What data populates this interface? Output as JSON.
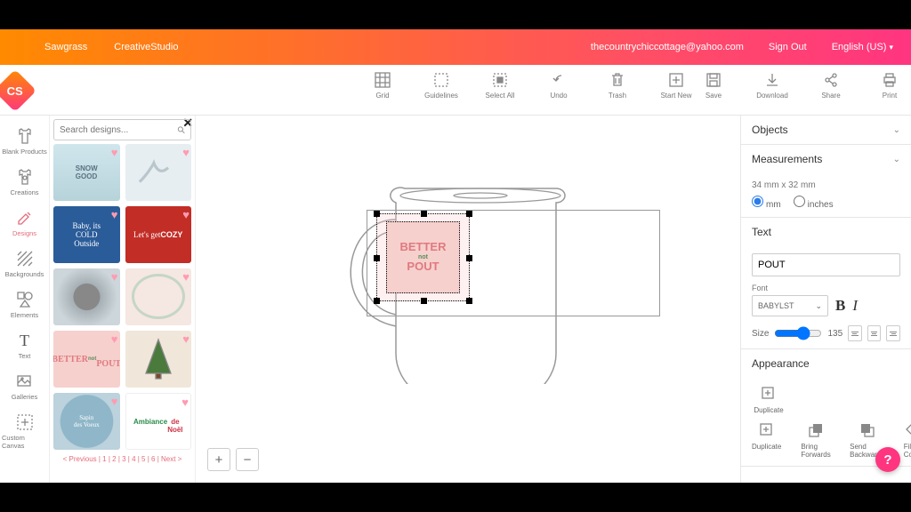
{
  "topbar": {
    "brand1": "Sawgrass",
    "brand2": "CreativeStudio",
    "email": "thecountrychiccottage@yahoo.com",
    "signout": "Sign Out",
    "language": "English (US)"
  },
  "toolbar": {
    "grid": "Grid",
    "guidelines": "Guidelines",
    "select_all": "Select All",
    "undo": "Undo",
    "trash": "Trash",
    "start_new": "Start New",
    "save": "Save",
    "download": "Download",
    "share": "Share",
    "print": "Print"
  },
  "sidebar": {
    "blank_products": "Blank Products",
    "creations": "Creations",
    "designs": "Designs",
    "backgrounds": "Backgrounds",
    "elements": "Elements",
    "text": "Text",
    "galleries": "Galleries",
    "custom_canvas": "Custom Canvas"
  },
  "browser": {
    "search_placeholder": "Search designs...",
    "pager": "< Previous | 1 | 2 | 3 | 4 | 5 | 6 | Next >"
  },
  "canvas": {
    "design_line1": "BETTER",
    "design_line2": "not",
    "design_line3": "POUT",
    "zoom_in": "+",
    "zoom_out": "−"
  },
  "panel": {
    "objects": "Objects",
    "measurements": "Measurements",
    "dim_text": "34 mm x 32 mm",
    "unit_mm": "mm",
    "unit_in": "inches",
    "text": "Text",
    "text_value": "POUT",
    "font_label": "Font",
    "font_value": "BABYLST",
    "bold": "B",
    "italic": "I",
    "size_label": "Size",
    "size_value": "135",
    "appearance": "Appearance",
    "duplicate": "Duplicate",
    "bring_fwd": "Bring Forwards",
    "send_back": "Send Backwards",
    "fill_color": "Fill Color",
    "help": "?"
  }
}
